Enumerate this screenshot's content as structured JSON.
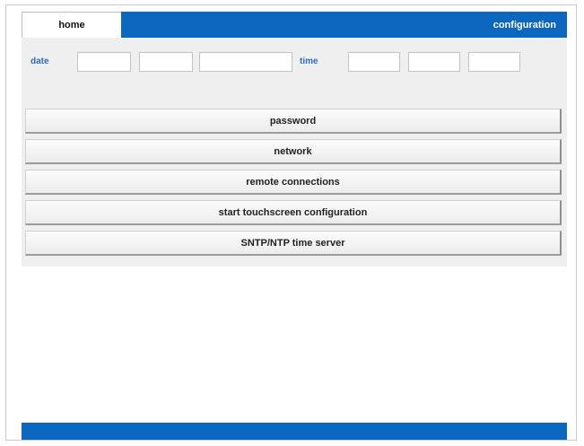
{
  "tabs": {
    "home": "home",
    "configuration": "configuration"
  },
  "datetime": {
    "date_label": "date",
    "time_label": "time",
    "date_fields": [
      "",
      "",
      ""
    ],
    "time_fields": [
      "",
      "",
      ""
    ]
  },
  "buttons": [
    {
      "label": "password"
    },
    {
      "label": "network"
    },
    {
      "label": "remote connections"
    },
    {
      "label": "start touchscreen configuration"
    },
    {
      "label": "SNTP/NTP time server"
    }
  ],
  "colors": {
    "accent_blue": "#0b66be",
    "label_blue": "#2a6fc4",
    "panel_gray": "#efefef"
  }
}
